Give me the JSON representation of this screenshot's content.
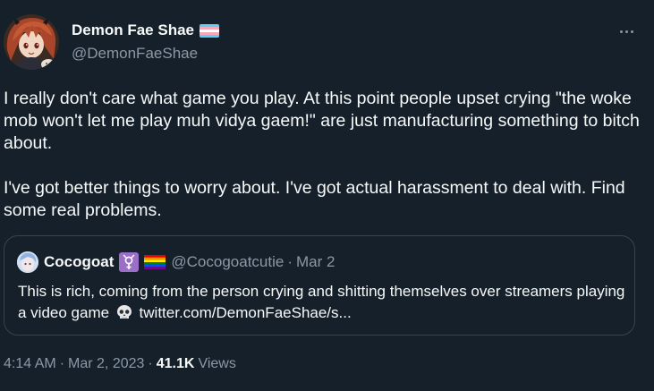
{
  "author": {
    "display_name": "Demon Fae Shae",
    "handle": "@DemonFaeShae",
    "name_flag_icon": "transgender-flag-icon"
  },
  "more_icon": "ellipsis-icon",
  "tweet": {
    "text": "I really don't care what game you play. At this point people upset crying \"the woke mob won't let me play muh vidya gaem!\" are just manufacturing something to bitch about.\n\nI've got better things to worry about. I've got actual harassment to deal with. Find some real problems."
  },
  "quote": {
    "display_name": "Cocogoat",
    "name_icons": [
      "transgender-symbol-icon",
      "rainbow-flag-icon"
    ],
    "handle": "@Cocogoatcutie",
    "separator": "·",
    "date": "Mar 2",
    "text_before": "This is rich, coming from the person crying and shitting themselves over streamers playing a video game",
    "text_icon": "skull-icon",
    "link": "twitter.com/DemonFaeShae/s..."
  },
  "footer": {
    "time": "4:14 AM",
    "separator": "·",
    "date": "Mar 2, 2023",
    "separator2": "·",
    "views_count": "41.1K",
    "views_label": "Views"
  },
  "colors": {
    "background": "#15202b",
    "text_primary": "#f7f9f9",
    "text_secondary": "#8b98a5",
    "border": "#38444d"
  }
}
